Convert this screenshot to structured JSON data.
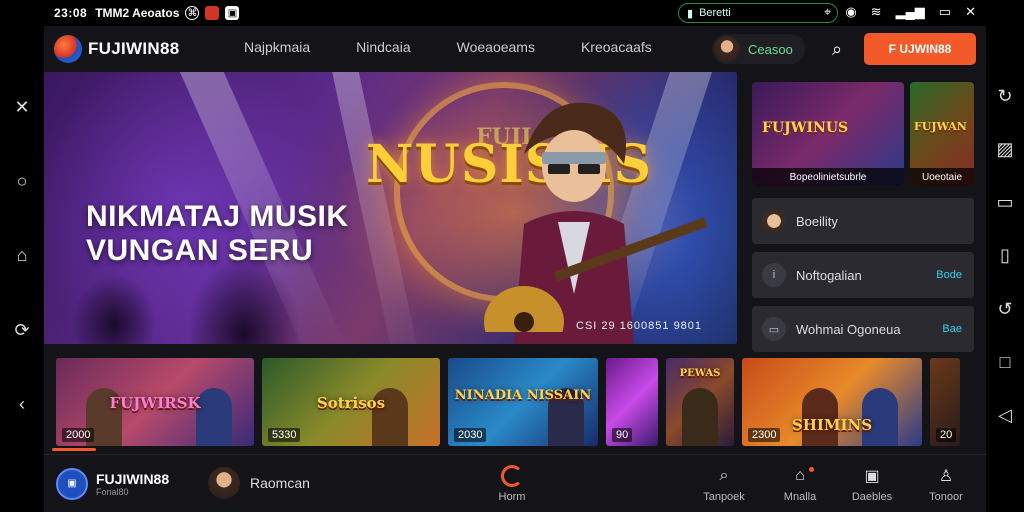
{
  "status_bar": {
    "time": "23:08",
    "carrier": "TMM2 Aeoatos",
    "pill_text": "Beretti"
  },
  "header": {
    "brand": "FUJIWIN88",
    "nav": [
      "Najpkmaia",
      "Nindcaia",
      "Woeaoeams",
      "Kreoacaafs"
    ],
    "user_name": "Ceasoo",
    "cta_label": "F UJWIN88"
  },
  "hero": {
    "headline_line1": "NIKMATAJ MUSIK",
    "headline_line2": "VUNGAN SERU",
    "logo_text": "NUSISHS",
    "logo_top": "FUJI",
    "meta": "CSI  29  1600851 9801"
  },
  "side_panel": {
    "featured": [
      {
        "title": "FUJWINUS",
        "label": "Bopeolinietsubrle"
      },
      {
        "title": "FUJWAN",
        "label": "Uoeotaie"
      }
    ],
    "list": [
      {
        "icon": "coin-icon",
        "label": "Boeility",
        "badge": ""
      },
      {
        "icon": "info-icon",
        "label": "Noftogalian",
        "badge": "Bode"
      },
      {
        "icon": "wallet-icon",
        "label": "Wohmai Ogoneua",
        "badge": "Bae"
      }
    ]
  },
  "thumbnails": [
    {
      "title": "FUJWIRSK",
      "price": "2000"
    },
    {
      "title": "Sotrisos",
      "price": "5330"
    },
    {
      "title": "NINADIA NISSAIN",
      "price": "2030"
    },
    {
      "title": "PEWAS",
      "price": "90"
    },
    {
      "title": "SHIMINS",
      "price": "2300"
    },
    {
      "title": "",
      "price": "20"
    }
  ],
  "bottom_bar": {
    "brand": "FUJIWIN88",
    "brand_sub": "Fonal80",
    "user_name": "Raomcan",
    "tabs": [
      {
        "label": "Horm",
        "icon": "home-icon"
      },
      {
        "label": "Tanpoek",
        "icon": "search-icon"
      },
      {
        "label": "Mnalla",
        "icon": "bag-icon"
      },
      {
        "label": "Daebles",
        "icon": "box-icon"
      },
      {
        "label": "Tonoor",
        "icon": "profile-icon"
      }
    ]
  },
  "colors": {
    "accent": "#f25a2a",
    "background": "#141418",
    "panel": "#2a2a30",
    "badge": "#3ad0e8",
    "online": "#6be08a"
  }
}
